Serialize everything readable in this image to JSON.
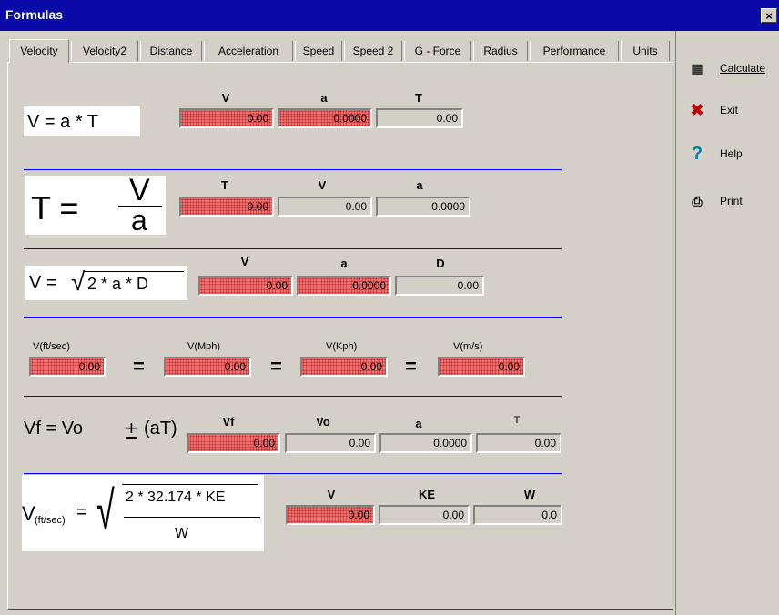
{
  "window": {
    "title": "Formulas",
    "close_label": "×"
  },
  "tabs": [
    "Velocity",
    "Velocity2",
    "Distance",
    "Acceleration",
    "Speed",
    "Speed 2",
    "G - Force",
    "Radius",
    "Performance",
    "Units"
  ],
  "sidebar": {
    "calculate": "Calculate",
    "exit": "Exit",
    "help": "Help",
    "print": "Print"
  },
  "row1": {
    "formula": "V = a * T",
    "headers": [
      "V",
      "a",
      "T"
    ],
    "values": [
      "0.00",
      "0.0000",
      "0.00"
    ]
  },
  "row2": {
    "formula_lhs": "T =",
    "formula_num": "V",
    "formula_den": "a",
    "headers": [
      "T",
      "V",
      "a"
    ],
    "values": [
      "0.00",
      "0.00",
      "0.0000"
    ]
  },
  "row3": {
    "formula_lhs": "V =",
    "formula_rad": "2 * a * D",
    "headers": [
      "V",
      "a",
      "D"
    ],
    "values": [
      "0.00",
      "0.0000",
      "0.00"
    ]
  },
  "row4": {
    "headers": [
      "V(ft/sec)",
      "V(Mph)",
      "V(Kph)",
      "V(m/s)"
    ],
    "values": [
      "0.00",
      "0.00",
      "0.00",
      "0.00"
    ],
    "equals": "="
  },
  "row5": {
    "formula_a": "Vf = Vo",
    "formula_pm": "+",
    "formula_b": "(aT)",
    "headers": [
      "Vf",
      "Vo",
      "a",
      "T"
    ],
    "values": [
      "0.00",
      "0.00",
      "0.0000",
      "0.00"
    ]
  },
  "row6": {
    "formula_v": "V",
    "formula_sub": "(ft/sec)",
    "formula_eq": "=",
    "formula_num": "2 * 32.174 * KE",
    "formula_den": "W",
    "headers": [
      "V",
      "KE",
      "W"
    ],
    "values": [
      "0.00",
      "0.00",
      "0.0"
    ]
  },
  "colors": {
    "titlebar": "#0a0aa8",
    "separator": "#0000ff",
    "input_red": "#f07070"
  }
}
